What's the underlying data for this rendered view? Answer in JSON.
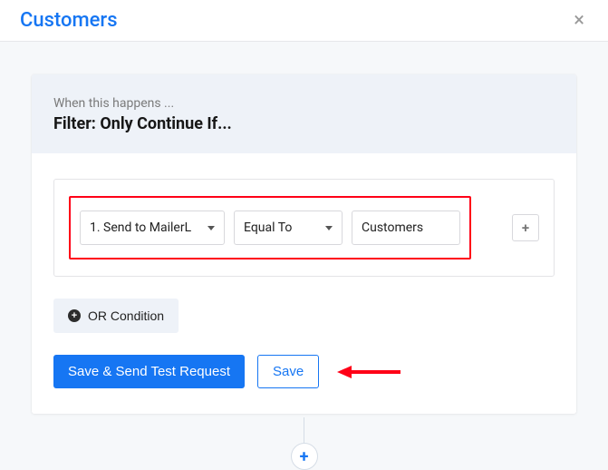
{
  "header": {
    "title": "Customers"
  },
  "card": {
    "subtitle": "When this happens ...",
    "title": "Filter: Only Continue If..."
  },
  "filter": {
    "field_label": "1. Send to MailerL",
    "operator_label": "Equal To",
    "value_text": "Customers",
    "plus_label": "+"
  },
  "or_condition": {
    "label": "OR Condition"
  },
  "actions": {
    "primary": "Save & Send Test Request",
    "secondary": "Save"
  },
  "add_step": {
    "label": "+"
  }
}
